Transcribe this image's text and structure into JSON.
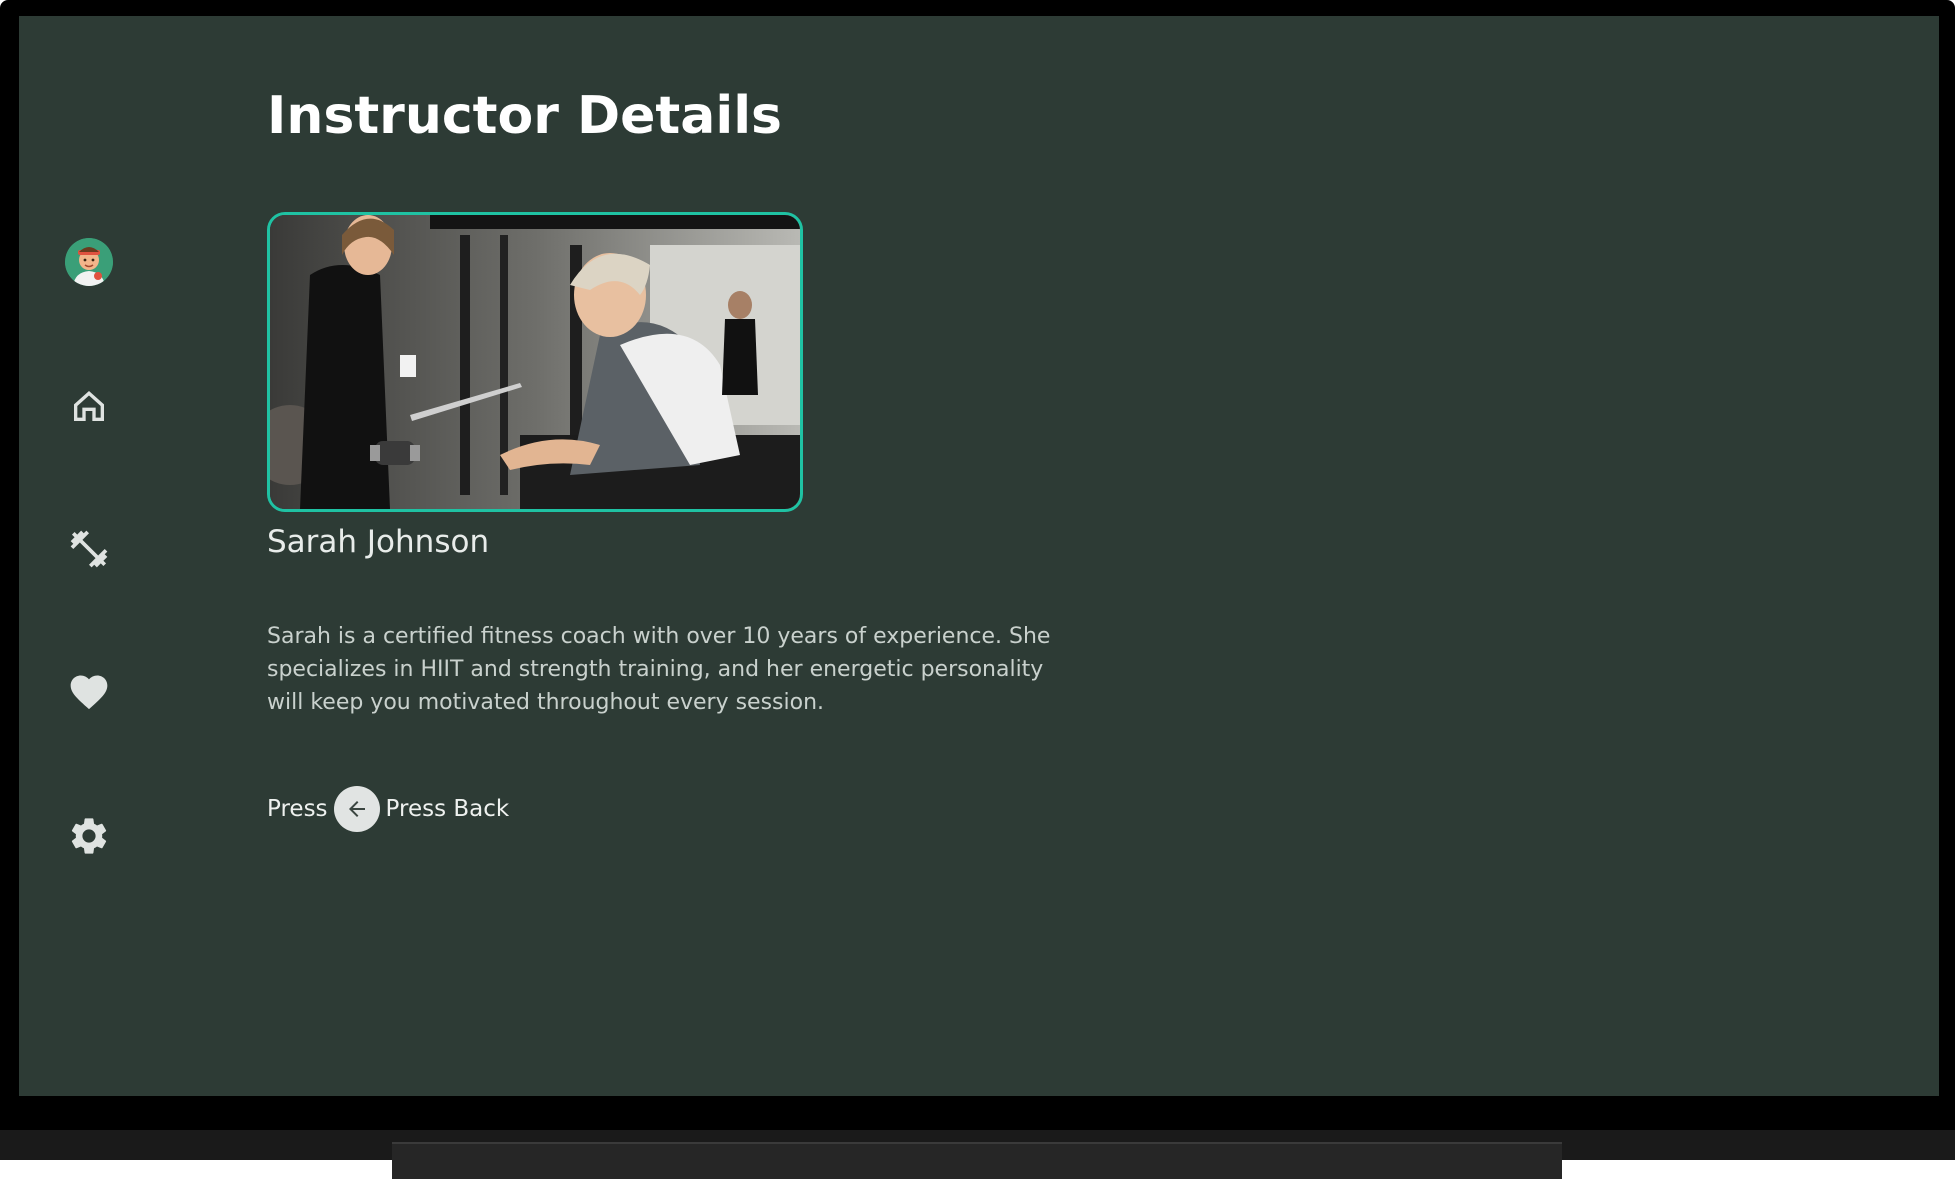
{
  "page": {
    "title": "Instructor Details"
  },
  "instructor": {
    "name": "Sarah Johnson",
    "bio": "Sarah is a certified fitness coach with over 10 years of experience. She specializes in HIIT and strength training, and her energetic personality will keep you motivated throughout every session."
  },
  "back_hint": {
    "prefix": "Press",
    "label": "Press Back",
    "icon": "arrow-back-icon"
  },
  "nav": {
    "items": [
      {
        "name": "profile",
        "icon": "avatar-icon"
      },
      {
        "name": "home",
        "icon": "home-icon"
      },
      {
        "name": "workouts",
        "icon": "dumbbell-icon"
      },
      {
        "name": "favorites",
        "icon": "heart-icon"
      },
      {
        "name": "settings",
        "icon": "gear-icon"
      }
    ]
  },
  "colors": {
    "background": "#2d3b35",
    "accent": "#1fc2a3",
    "nav_icon": "#dfe3e1",
    "text_primary": "#ffffff",
    "text_secondary": "#c9d1cd"
  }
}
